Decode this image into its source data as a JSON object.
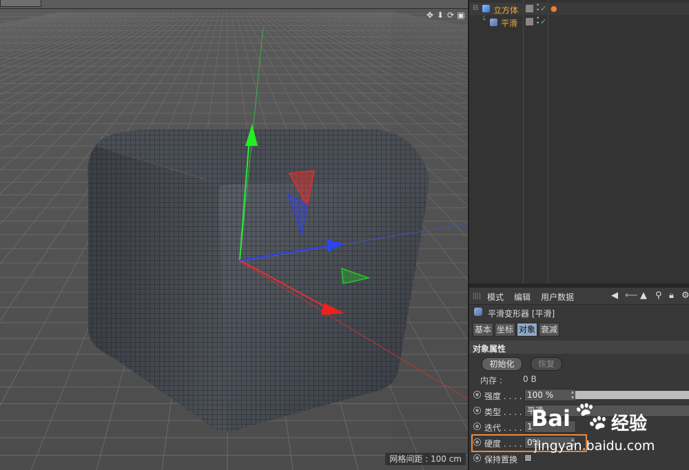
{
  "viewport": {
    "nav_icons": [
      "move-icon",
      "down-arrow-icon",
      "rotate-icon",
      "maximize-icon"
    ],
    "nav_glyphs": [
      "✥",
      "⬇",
      "⟳",
      "▣"
    ],
    "grid_spacing": "网格间距 : 100 cm"
  },
  "object_manager": {
    "objects": [
      {
        "label": "立方体",
        "tree": "⊟",
        "icon": "cube-icon"
      },
      {
        "label": "平滑",
        "tree": "└",
        "icon": "smoothing-deformer-icon"
      }
    ]
  },
  "attribute_manager": {
    "menu": [
      "模式",
      "编辑",
      "用户数据"
    ],
    "object_title": "平滑变形器 [平滑]",
    "tabs": [
      "基本",
      "坐标",
      "对象",
      "衰减"
    ],
    "active_tab": "对象",
    "section_title": "对象属性",
    "init_button": "初始化",
    "reset_button": "恢复",
    "memory_label": "内存 :",
    "memory_value": "0 B",
    "params": [
      {
        "label": "强度 . . . .",
        "value": "100 %"
      },
      {
        "label": "类型 . . . .",
        "value": "平滑"
      },
      {
        "label": "迭代 . . . .",
        "value": "1"
      },
      {
        "label": "硬度 . . . .",
        "value": "0%"
      },
      {
        "label": "保持置换",
        "value": ""
      }
    ]
  },
  "watermark": {
    "brand_bai": "Bai",
    "brand_cn": "经验",
    "url": "jingyan.baidu.com"
  },
  "colors": {
    "highlight": "#f08a3a",
    "active_tab": "#8fa9c7",
    "object_label": "#f0a830"
  }
}
